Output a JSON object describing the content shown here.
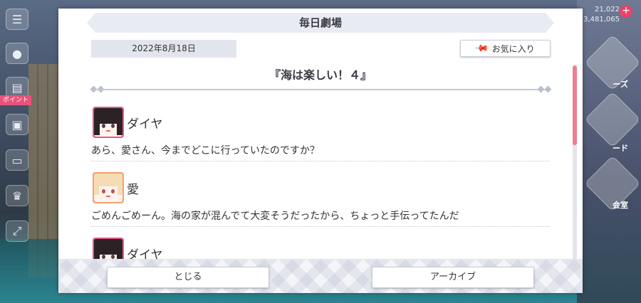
{
  "hud": {
    "value1": "21,022",
    "value2": "3,481,065"
  },
  "side_tag": "ポイント",
  "right_labels": [
    "ーズ",
    "ード",
    "会室"
  ],
  "modal": {
    "title": "毎日劇場",
    "date": "2022年8月18日",
    "favorite_label": "お気に入り",
    "episode_title": "『海は楽しい！４』",
    "entries": [
      {
        "speaker": "ダイヤ",
        "text": "あら、愛さん、今までどこに行っていたのですか？"
      },
      {
        "speaker": "愛",
        "text": "ごめんごめーん。海の家が混んでて大変そうだったから、ちょっと手伝ってたんだ"
      },
      {
        "speaker": "ダイヤ",
        "text": ""
      }
    ],
    "close_label": "とじる",
    "archive_label": "アーカイブ"
  },
  "colors": {
    "accent_pink": "#e25a86",
    "scroll_thumb": "#ee7d8f",
    "avatar_orange": "#f6a26e"
  }
}
